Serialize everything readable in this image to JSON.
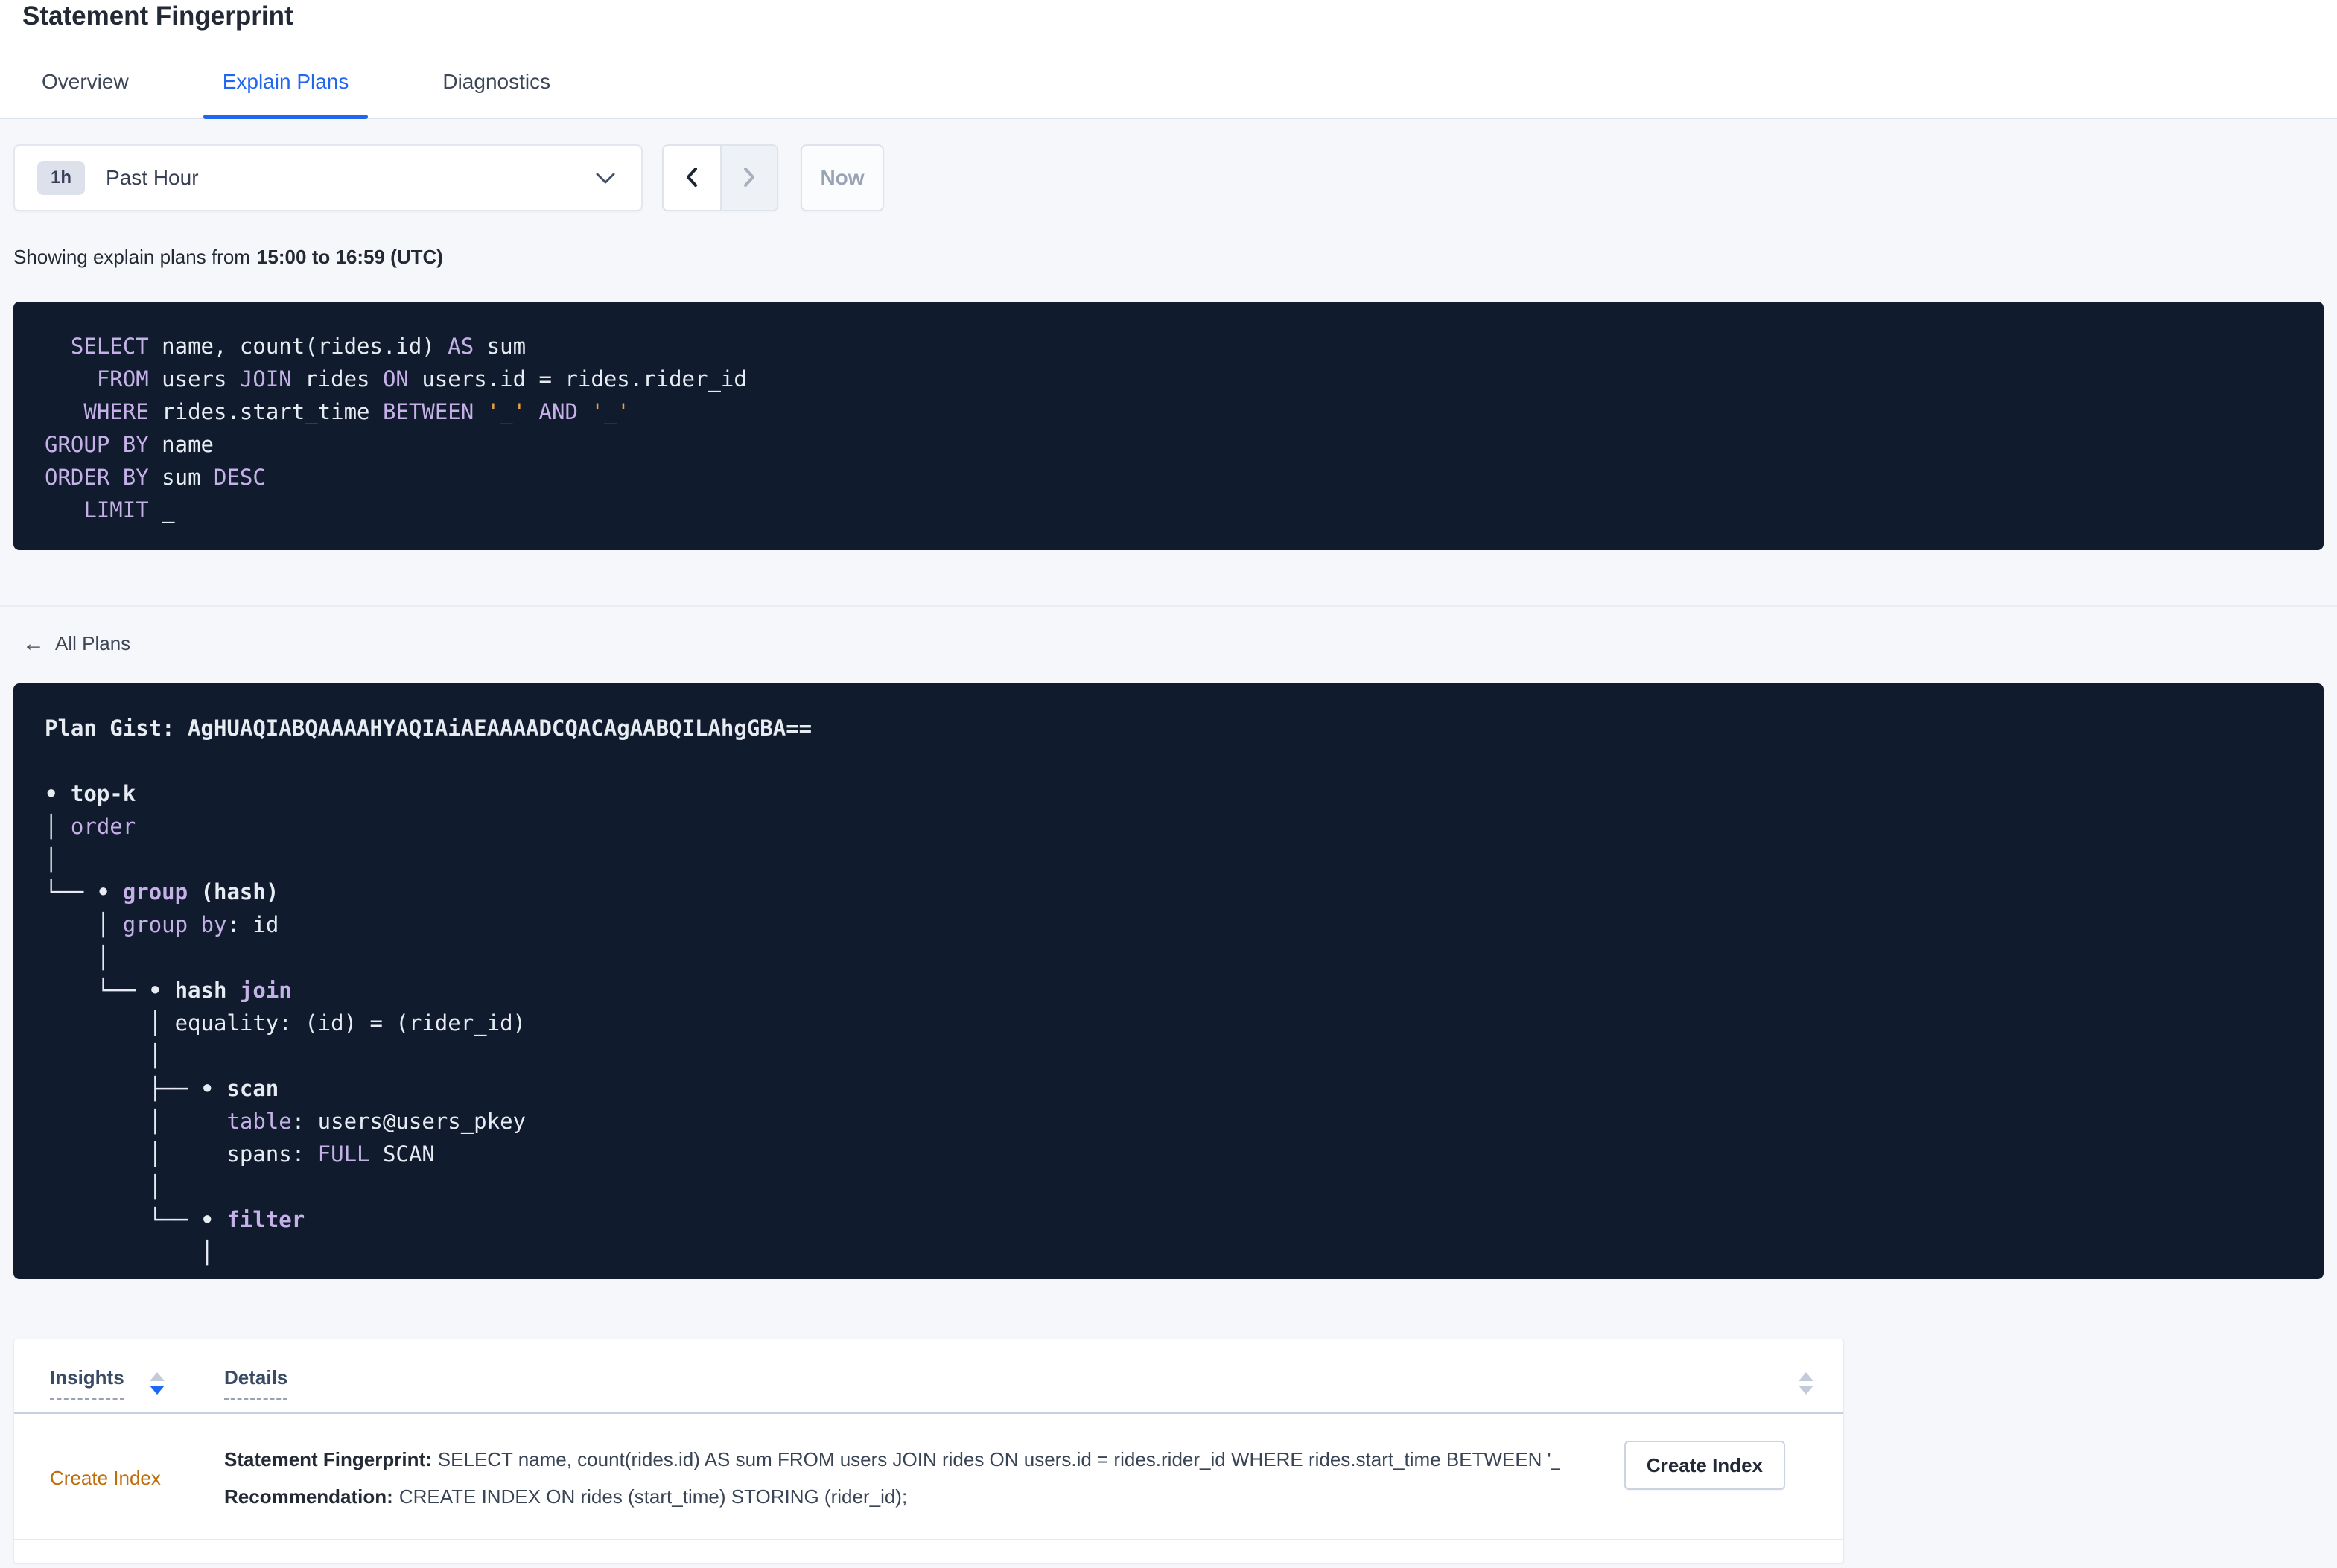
{
  "page": {
    "title": "Statement Fingerprint"
  },
  "tabs": [
    {
      "label": "Overview",
      "active": false
    },
    {
      "label": "Explain Plans",
      "active": true
    },
    {
      "label": "Diagnostics",
      "active": false
    }
  ],
  "time_picker": {
    "duration_badge": "1h",
    "selected": "Past Hour",
    "now_label": "Now"
  },
  "showing": {
    "prefix": "Showing explain plans from",
    "range": "15:00 to 16:59 (UTC)"
  },
  "sql_block": {
    "lines": [
      {
        "s": [
          {
            "t": "  "
          },
          {
            "c": "k",
            "t": "SELECT"
          },
          {
            "t": " name, count(rides.id) "
          },
          {
            "c": "k",
            "t": "AS"
          },
          {
            "t": " sum"
          }
        ]
      },
      {
        "s": [
          {
            "t": "    "
          },
          {
            "c": "k",
            "t": "FROM"
          },
          {
            "t": " users "
          },
          {
            "c": "k",
            "t": "JOIN"
          },
          {
            "t": " rides "
          },
          {
            "c": "k",
            "t": "ON"
          },
          {
            "t": " users.id = rides.rider_id"
          }
        ]
      },
      {
        "s": [
          {
            "t": "   "
          },
          {
            "c": "k",
            "t": "WHERE"
          },
          {
            "t": " rides.start_time "
          },
          {
            "c": "k",
            "t": "BETWEEN"
          },
          {
            "t": " "
          },
          {
            "c": "o",
            "t": "'_'"
          },
          {
            "t": " "
          },
          {
            "c": "k",
            "t": "AND"
          },
          {
            "t": " "
          },
          {
            "c": "o",
            "t": "'_'"
          }
        ]
      },
      {
        "s": [
          {
            "c": "k",
            "t": "GROUP BY"
          },
          {
            "t": " name"
          }
        ]
      },
      {
        "s": [
          {
            "c": "k",
            "t": "ORDER BY"
          },
          {
            "t": " sum "
          },
          {
            "c": "k",
            "t": "DESC"
          }
        ]
      },
      {
        "s": [
          {
            "t": "   "
          },
          {
            "c": "k",
            "t": "LIMIT"
          },
          {
            "t": " _"
          }
        ]
      }
    ]
  },
  "all_plans": {
    "label": "All Plans"
  },
  "plan_block": {
    "gist": "AgHUAQIABQAAAAHYAQIAiAEAAAADCQACAgAABQILAhgGBA==",
    "lines": [
      {
        "b": 1,
        "s": [
          {
            "t": "Plan Gist: AgHUAQIABQAAAAHYAQIAiAEAAAADCQACAgAABQILAhgGBA=="
          }
        ]
      },
      {
        "s": [
          {
            "t": ""
          }
        ]
      },
      {
        "b": 1,
        "s": [
          {
            "t": "• top-k"
          }
        ]
      },
      {
        "s": [
          {
            "t": "│ "
          },
          {
            "c": "k",
            "t": "order"
          }
        ]
      },
      {
        "s": [
          {
            "t": "│"
          }
        ]
      },
      {
        "b": 1,
        "s": [
          {
            "t": "└── • "
          },
          {
            "c": "k",
            "t": "group"
          },
          {
            "t": " (hash)"
          }
        ]
      },
      {
        "s": [
          {
            "t": "    │ "
          },
          {
            "c": "k",
            "t": "group by"
          },
          {
            "t": ": id"
          }
        ]
      },
      {
        "s": [
          {
            "t": "    │"
          }
        ]
      },
      {
        "b": 1,
        "s": [
          {
            "t": "    └── • hash "
          },
          {
            "c": "k",
            "t": "join"
          }
        ]
      },
      {
        "s": [
          {
            "t": "        │ equality: (id) = (rider_id)"
          }
        ]
      },
      {
        "s": [
          {
            "t": "        │"
          }
        ]
      },
      {
        "b": 1,
        "s": [
          {
            "t": "        ├── • scan"
          }
        ]
      },
      {
        "s": [
          {
            "t": "        │     "
          },
          {
            "c": "k",
            "t": "table"
          },
          {
            "t": ": users@users_pkey"
          }
        ]
      },
      {
        "s": [
          {
            "t": "        │     spans: "
          },
          {
            "c": "k",
            "t": "FULL"
          },
          {
            "t": " SCAN"
          }
        ]
      },
      {
        "s": [
          {
            "t": "        │"
          }
        ]
      },
      {
        "b": 1,
        "s": [
          {
            "t": "        └── • "
          },
          {
            "c": "k",
            "t": "filter"
          }
        ]
      },
      {
        "s": [
          {
            "t": "            │"
          }
        ]
      }
    ]
  },
  "insights_table": {
    "columns": [
      {
        "label": "Insights",
        "sorted": "desc"
      },
      {
        "label": "Details",
        "sorted": "none"
      }
    ],
    "row": {
      "insight": "Create Index",
      "details": [
        {
          "label": "Statement Fingerprint:",
          "text": "SELECT name, count(rides.id) AS sum FROM users JOIN rides ON users.id = rides.rider_id WHERE rides.start_time BETWEEN '_…"
        },
        {
          "label": "Recommendation:",
          "text": "CREATE INDEX ON rides (start_time) STORING (rider_id);"
        }
      ],
      "action_label": "Create Index"
    }
  },
  "colors": {
    "accent_blue": "#2166ee",
    "insight_link_orange": "#bf6c09",
    "code_bg": "#111b2e",
    "code_keyword": "#c5b1e8",
    "code_placeholder": "#f0a13f",
    "page_bg": "#f5f7fa"
  }
}
